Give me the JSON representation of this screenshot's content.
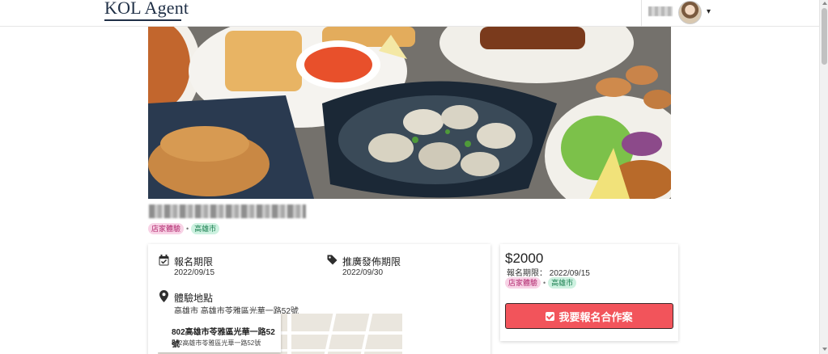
{
  "header": {
    "logo_text": "KOL Agent",
    "user_menu_caret": "▾"
  },
  "campaign": {
    "tags": [
      "店家體驗",
      "高雄市"
    ],
    "separator": "•"
  },
  "details": {
    "signup_deadline_label": "報名期限",
    "signup_deadline_value": "2022/09/15",
    "publish_deadline_label": "推廣發佈期限",
    "publish_deadline_value": "2022/09/30",
    "location_label": "體驗地點",
    "location_value": "高雄市 高雄市苓雅區光華一路52號"
  },
  "map": {
    "popup_title": "802高雄市苓雅區光華一路52號",
    "popup_subtitle": "802高雄市苓雅區光華一路52號"
  },
  "sidebar_card": {
    "price": "$2000",
    "deadline_text": "報名期限： 2022/09/15",
    "tags": [
      "店家體驗",
      "高雄市"
    ],
    "apply_button_label": "我要報名合作案"
  },
  "colors": {
    "brand_navy": "#1f2f46",
    "apply_button": "#f2545b",
    "tag_pink_bg": "#f8d3e6",
    "tag_green_bg": "#cdf1e0"
  }
}
